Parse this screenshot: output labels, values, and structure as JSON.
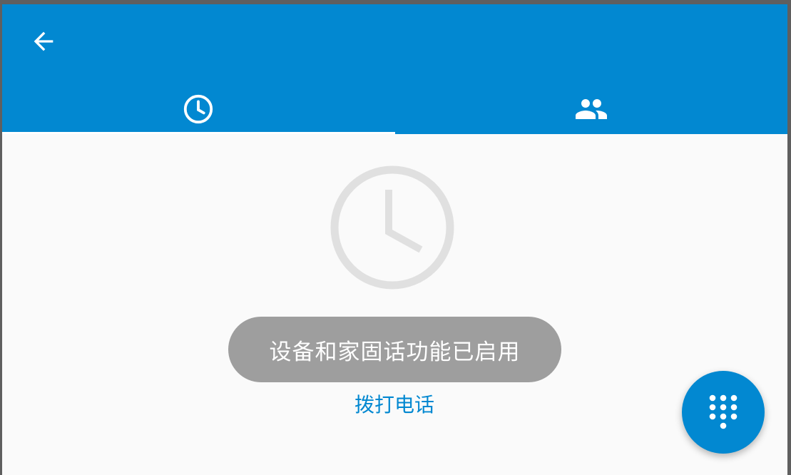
{
  "app": {
    "accent_color": "#0288d1",
    "background_color": "#fafafa"
  },
  "header": {
    "back_icon": "arrow-back-icon"
  },
  "tabs": [
    {
      "icon": "clock-icon",
      "selected": true
    },
    {
      "icon": "people-icon",
      "selected": false
    }
  ],
  "empty_state": {
    "icon": "clock-icon"
  },
  "toast": {
    "text": "设备和家固话功能已启用"
  },
  "call_link": {
    "label": "拨打电话"
  },
  "fab": {
    "icon": "dialpad-icon"
  }
}
